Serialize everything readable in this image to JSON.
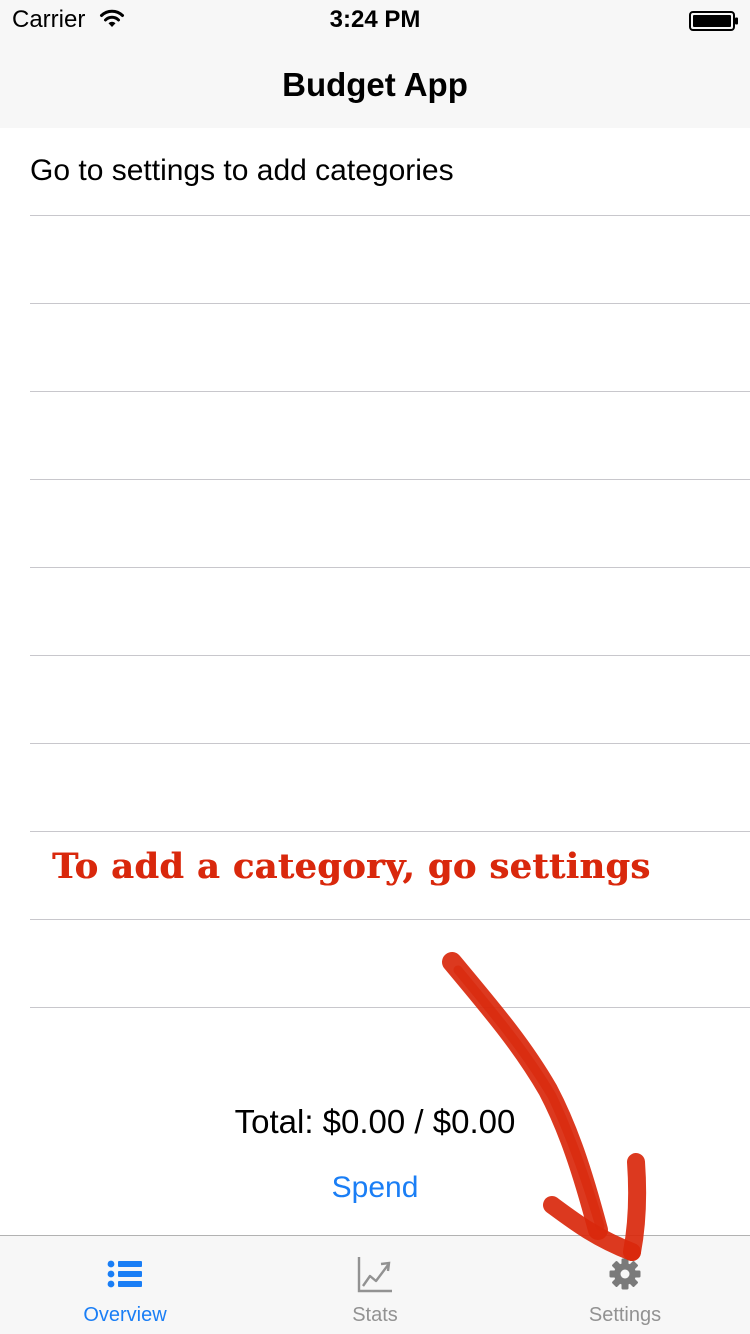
{
  "status_bar": {
    "carrier": "Carrier",
    "time": "3:24 PM"
  },
  "nav": {
    "title": "Budget App"
  },
  "table": {
    "rows": [
      "Go to settings to add categories",
      "",
      "",
      "",
      "",
      "",
      "",
      "",
      "",
      ""
    ]
  },
  "annotation": {
    "text": "To add a category, go settings",
    "color": "#d9280c"
  },
  "footer": {
    "total": "Total: $0.00 / $0.00",
    "spend_label": "Spend"
  },
  "tab_bar": {
    "selected": "overview",
    "tabs": [
      {
        "id": "overview",
        "label": "Overview",
        "icon": "list-icon"
      },
      {
        "id": "stats",
        "label": "Stats",
        "icon": "chart-icon"
      },
      {
        "id": "settings",
        "label": "Settings",
        "icon": "gear-icon"
      }
    ]
  },
  "colors": {
    "accent": "#1a7ef5",
    "inactive": "#929292",
    "separator": "#c8c7cc",
    "bar_background": "#f7f7f7"
  }
}
